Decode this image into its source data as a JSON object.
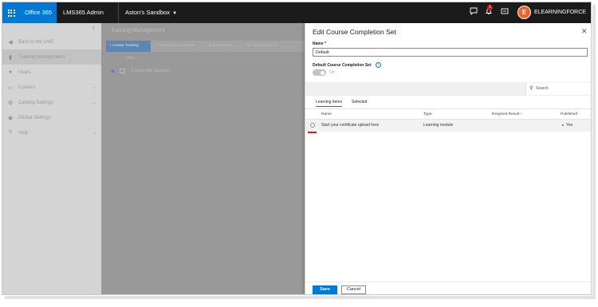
{
  "topbar": {
    "brand": "Office 365",
    "app_title": "LMS365 Admin Center",
    "site": "Aston's Sandbox",
    "notification_count": "1",
    "avatar_initial": "E",
    "org_name": "ELEARNINGFORCE USA",
    "accent": "#0078d4"
  },
  "nav": {
    "items": [
      {
        "label": "Back to the LMS",
        "icon": "back-circle-icon"
      },
      {
        "label": "Training Management",
        "icon": "book-icon"
      },
      {
        "label": "Users",
        "icon": "users-icon"
      },
      {
        "label": "Content",
        "icon": "folder-icon"
      },
      {
        "label": "Catalog Settings",
        "icon": "gear-icon"
      },
      {
        "label": "Global Settings",
        "icon": "globe-icon"
      },
      {
        "label": "Help",
        "icon": "help-icon"
      }
    ]
  },
  "main": {
    "title": "Training Management",
    "commands": {
      "create": "+ Create Training",
      "import": "Import SCO courses",
      "select_view": "Select View",
      "reports": "Training reports"
    },
    "column_title": "Title ↑",
    "row_title": "Embed URL Example"
  },
  "panel": {
    "title": "Edit Course Completion Set",
    "name_label": "Name *",
    "name_value": "Default",
    "default_label": "Default Course Completion Set",
    "toggle_label": "On",
    "search_placeholder": "Search",
    "tabs": [
      "Learning Items",
      "Selected"
    ],
    "columns": {
      "name": "Name",
      "type": "Type",
      "required_result": "Required Result ↕",
      "published": "Published"
    },
    "rows": [
      {
        "name": "Start your certificate upload here",
        "type": "Learning module",
        "published": "Yes"
      }
    ],
    "save": "Save",
    "cancel": "Cancel"
  }
}
